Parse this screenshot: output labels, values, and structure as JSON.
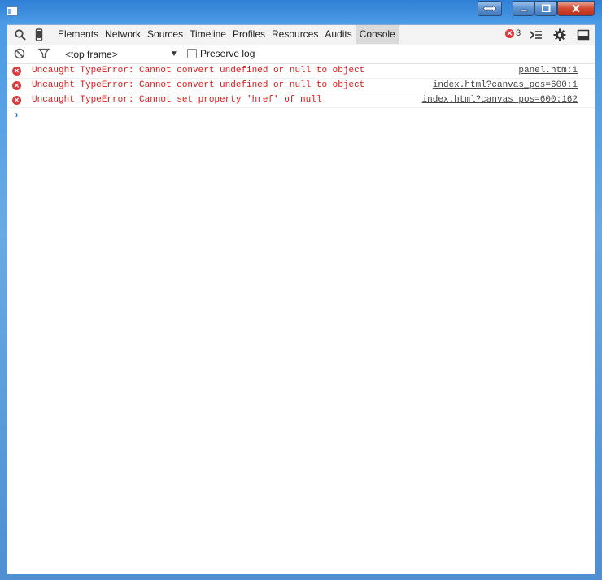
{
  "window": {
    "controls": {
      "snap": "snap",
      "minimize": "minimize",
      "maximize": "maximize",
      "close": "close"
    }
  },
  "toolbar": {
    "icons": [
      "search-icon",
      "device-mode-icon",
      "drawer-toggle-icon",
      "settings-gear-icon",
      "dock-side-icon"
    ],
    "tabs": [
      {
        "label": "Elements"
      },
      {
        "label": "Network"
      },
      {
        "label": "Sources"
      },
      {
        "label": "Timeline"
      },
      {
        "label": "Profiles"
      },
      {
        "label": "Resources"
      },
      {
        "label": "Audits"
      },
      {
        "label": "Console"
      }
    ],
    "selected_tab": "Console",
    "error_count": "3"
  },
  "filterbar": {
    "frame": "<top frame>",
    "preserve_log_label": "Preserve log",
    "preserve_log_checked": false
  },
  "console": {
    "messages": [
      {
        "text": "Uncaught TypeError: Cannot convert undefined or null to object",
        "source": "panel.htm:1"
      },
      {
        "text": "Uncaught TypeError: Cannot convert undefined or null to object",
        "source": "index.html?canvas_pos=600:1"
      },
      {
        "text": "Uncaught TypeError: Cannot set property 'href' of null",
        "source": "index.html?canvas_pos=600:162"
      }
    ],
    "prompt_symbol": "›"
  },
  "colors": {
    "error": "#e01818",
    "prompt": "#2d7be0",
    "error_badge": "#e0393e"
  }
}
